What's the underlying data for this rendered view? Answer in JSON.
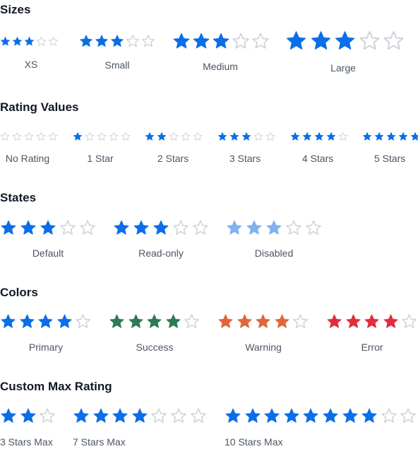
{
  "icons": {
    "filled": "star-filled-icon",
    "empty": "star-outline-icon"
  },
  "colors": {
    "primary": "#0b6ee8",
    "primary_disabled": "#7fb2f0",
    "success": "#2e7a55",
    "warning": "#e0663a",
    "error": "#e02d3c",
    "empty_outline": "#cfd4da",
    "heading": "#111827",
    "caption": "#4b5563"
  },
  "sections": {
    "sizes": {
      "title": "Sizes",
      "items": [
        {
          "label": "XS",
          "value": 3,
          "max": 5
        },
        {
          "label": "Small",
          "value": 3,
          "max": 5
        },
        {
          "label": "Medium",
          "value": 3,
          "max": 5
        },
        {
          "label": "Large",
          "value": 3,
          "max": 5
        }
      ]
    },
    "values": {
      "title": "Rating Values",
      "items": [
        {
          "label": "No Rating",
          "value": 0,
          "max": 5
        },
        {
          "label": "1 Star",
          "value": 1,
          "max": 5
        },
        {
          "label": "2 Stars",
          "value": 2,
          "max": 5
        },
        {
          "label": "3 Stars",
          "value": 3,
          "max": 5
        },
        {
          "label": "4 Stars",
          "value": 4,
          "max": 5
        },
        {
          "label": "5 Stars",
          "value": 5,
          "max": 5
        }
      ]
    },
    "states": {
      "title": "States",
      "items": [
        {
          "label": "Default",
          "value": 3,
          "max": 5,
          "interactive": true
        },
        {
          "label": "Read-only",
          "value": 3,
          "max": 5,
          "interactive": false
        },
        {
          "label": "Disabled",
          "value": 3,
          "max": 5,
          "interactive": false
        }
      ]
    },
    "colors": {
      "title": "Colors",
      "items": [
        {
          "label": "Primary",
          "value": 4,
          "max": 5,
          "color": "primary"
        },
        {
          "label": "Success",
          "value": 4,
          "max": 5,
          "color": "success"
        },
        {
          "label": "Warning",
          "value": 4,
          "max": 5,
          "color": "warning"
        },
        {
          "label": "Error",
          "value": 4,
          "max": 5,
          "color": "error"
        }
      ]
    },
    "custom_max": {
      "title": "Custom Max Rating",
      "items": [
        {
          "label": "3 Stars Max",
          "value": 2,
          "max": 3
        },
        {
          "label": "7 Stars Max",
          "value": 4,
          "max": 7
        },
        {
          "label": "10 Stars Max",
          "value": 8,
          "max": 10
        }
      ]
    }
  }
}
